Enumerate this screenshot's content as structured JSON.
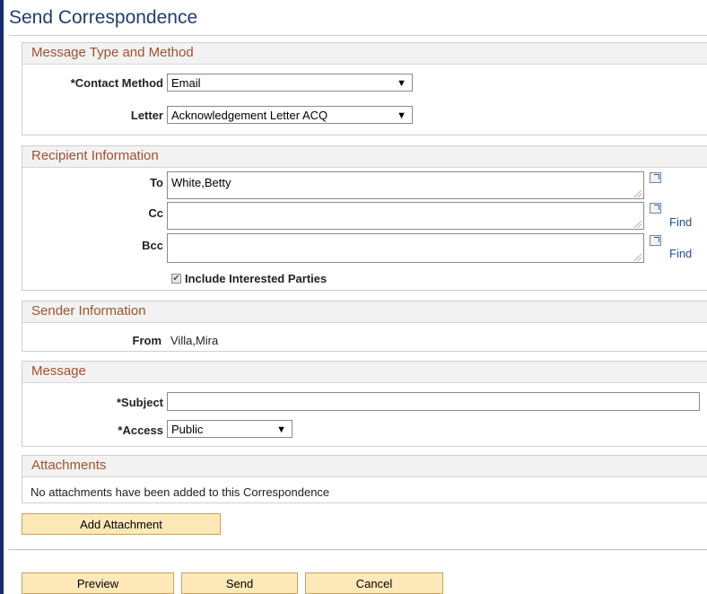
{
  "page": {
    "title": "Send Correspondence"
  },
  "message_type": {
    "header": "Message Type and Method",
    "contact_method": {
      "label": "*Contact Method",
      "value": "Email"
    },
    "letter": {
      "label": "Letter",
      "value": "Acknowledgement Letter ACQ"
    }
  },
  "recipient": {
    "header": "Recipient Information",
    "to": {
      "label": "To",
      "value": "White,Betty"
    },
    "cc": {
      "label": "Cc",
      "value": "",
      "find": "Find"
    },
    "bcc": {
      "label": "Bcc",
      "value": "",
      "find": "Find"
    },
    "include_parties": {
      "label": "Include Interested Parties",
      "checked": true
    }
  },
  "sender": {
    "header": "Sender Information",
    "from": {
      "label": "From",
      "value": "Villa,Mira"
    }
  },
  "message": {
    "header": "Message",
    "subject": {
      "label": "*Subject",
      "value": ""
    },
    "access": {
      "label": "*Access",
      "value": "Public"
    }
  },
  "attachments": {
    "header": "Attachments",
    "empty_text": "No attachments have been added to this Correspondence",
    "add_button": "Add Attachment"
  },
  "footer": {
    "preview": "Preview",
    "send": "Send",
    "cancel": "Cancel"
  },
  "icons": {
    "dropdown": "dropdown-arrow-icon",
    "expand": "expand-icon",
    "check": "checkmark-icon"
  }
}
